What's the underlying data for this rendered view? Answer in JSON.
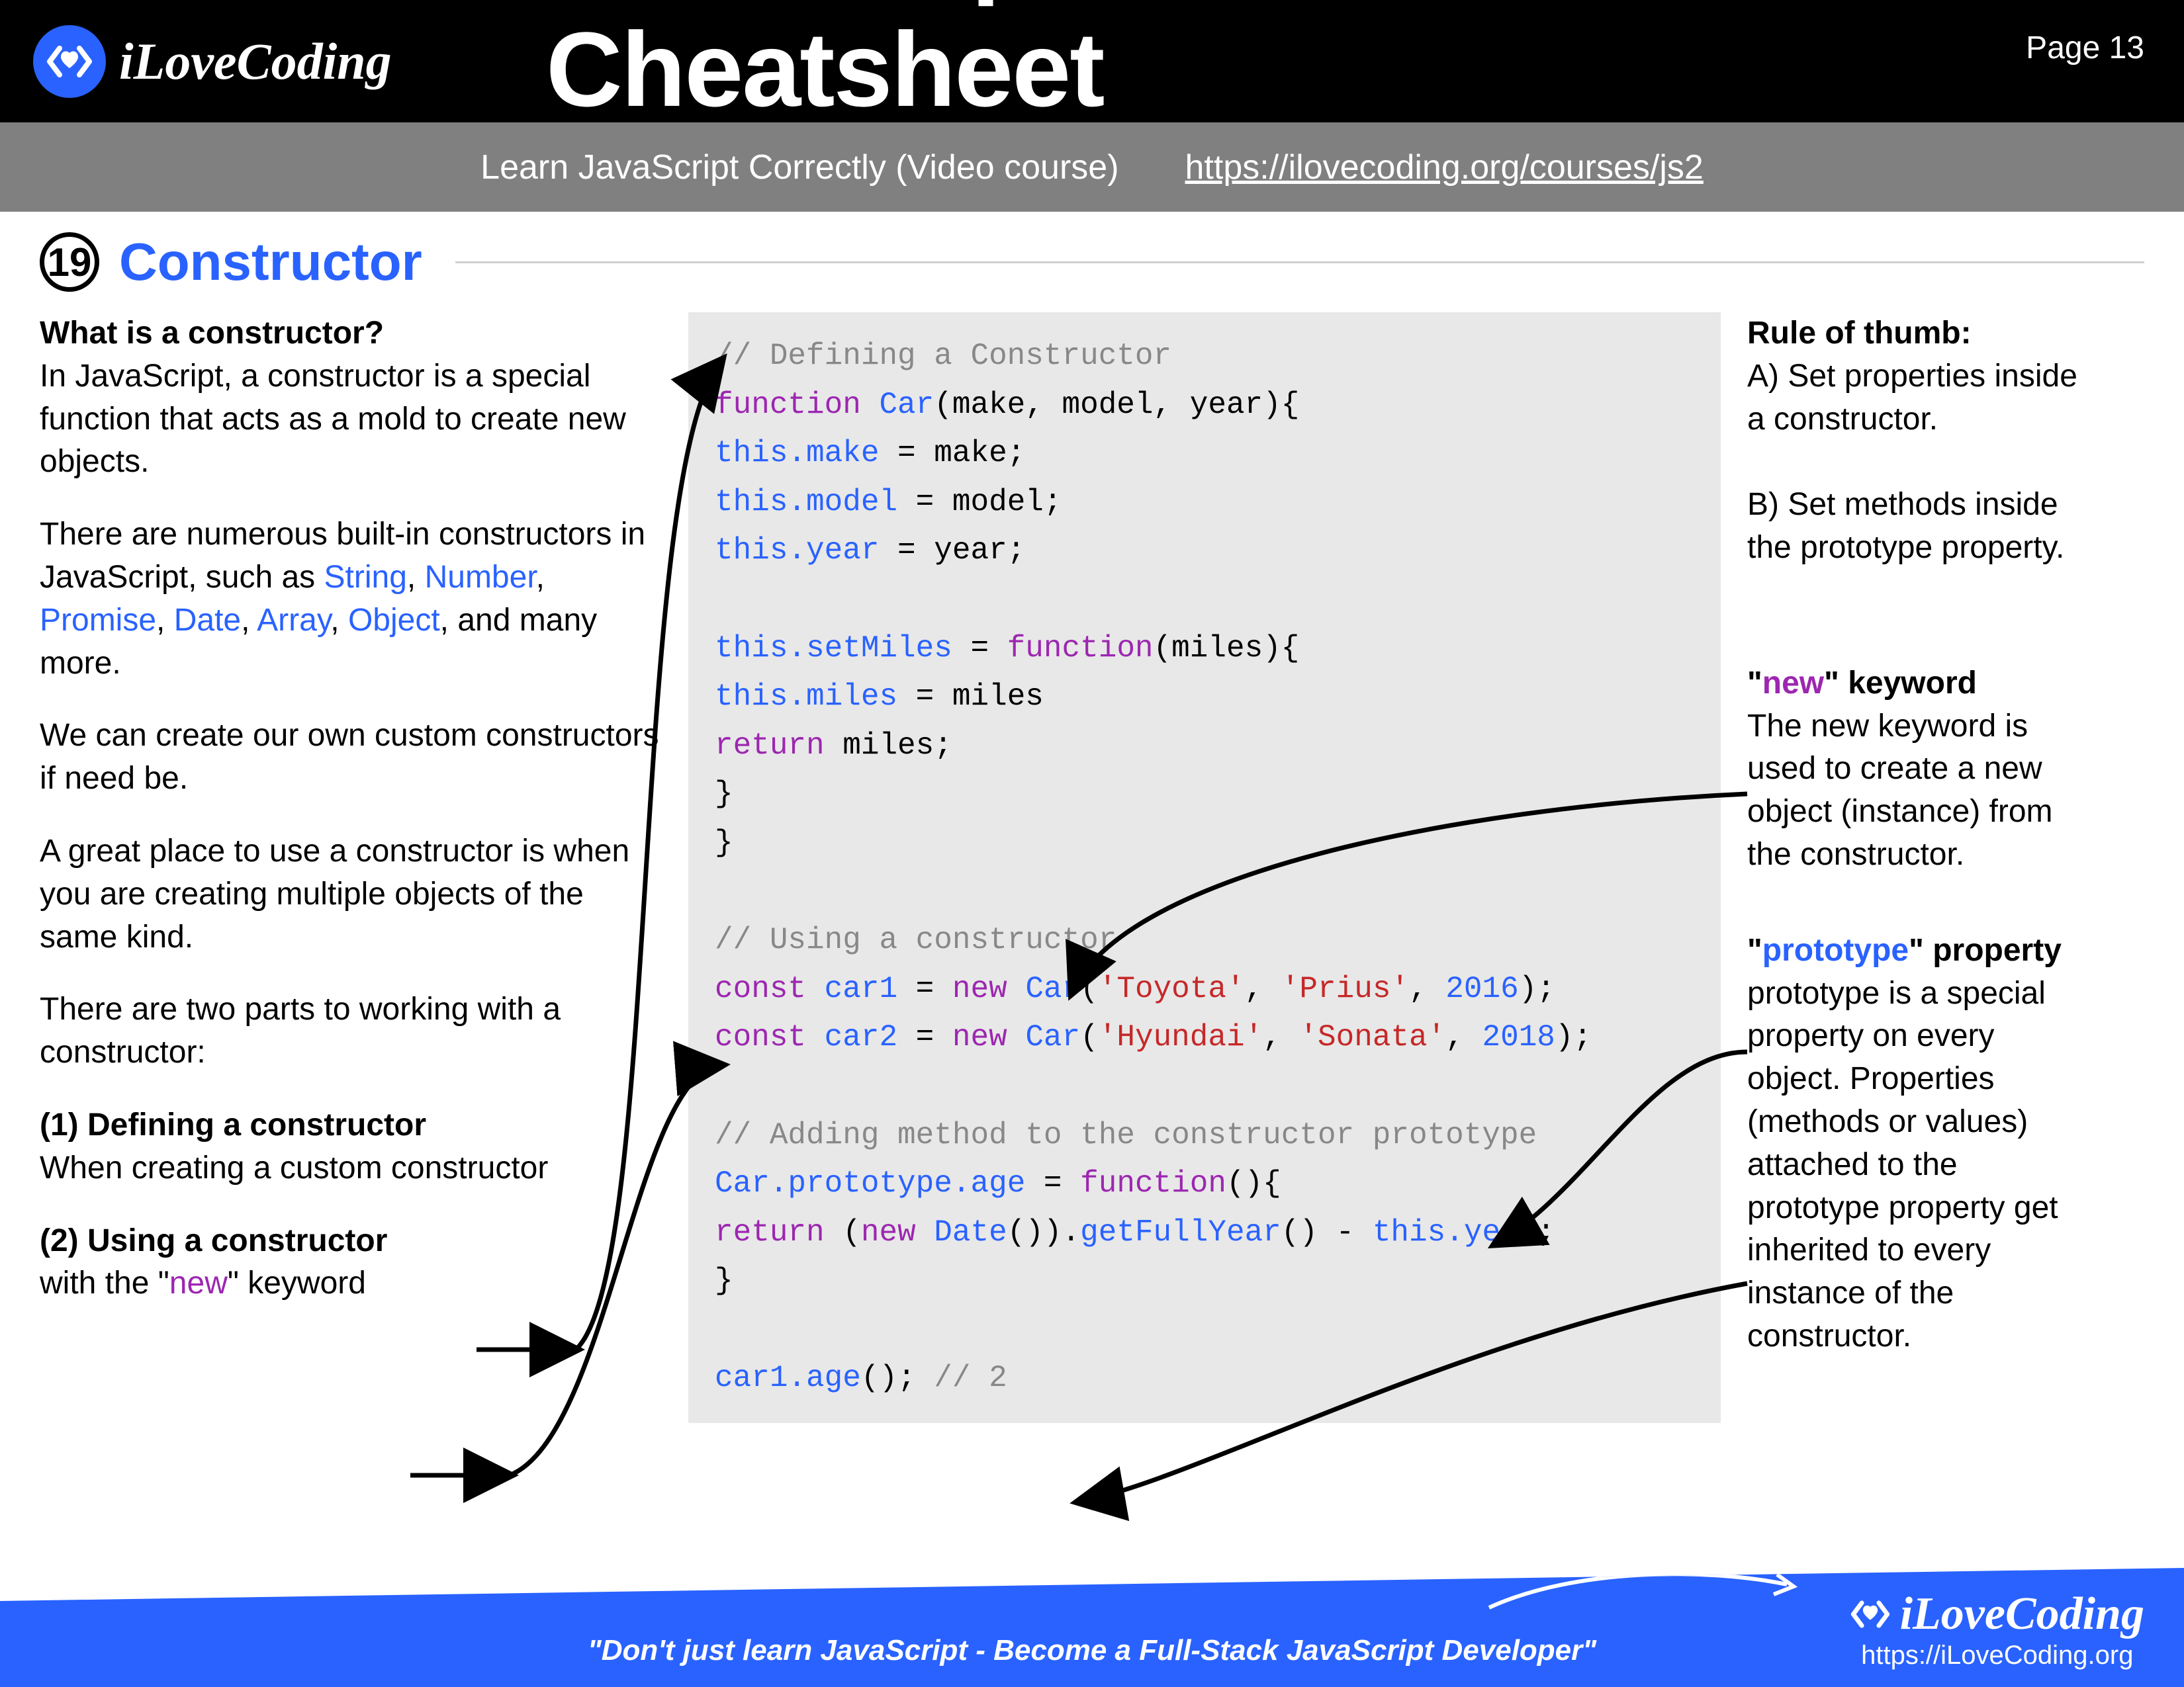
{
  "header": {
    "brand": "iLoveCoding",
    "title": "JavaScript Cheatsheet",
    "page_label": "Page 13",
    "subtitle": "Learn JavaScript Correctly (Video course)",
    "link": "https://ilovecoding.org/courses/js2"
  },
  "section": {
    "number": "19",
    "title": "Constructor"
  },
  "left": {
    "q_title": "What is a constructor?",
    "p1": "In JavaScript, a constructor is a special function that acts as a mold to create new objects.",
    "p2a": "There are numerous built-in constructors in JavaScript, such as ",
    "builtins": [
      "String",
      "Number",
      "Promise",
      "Date",
      "Array",
      "Object"
    ],
    "p2b": ", and many more.",
    "p3": "We can create our own custom constructors if need be.",
    "p4": "A great place to use a constructor is when you are creating multiple objects of the same kind.",
    "p5": "There are two parts to working with a constructor:",
    "part1_title": "(1) Defining a constructor",
    "part1_body": "When creating a custom constructor",
    "part2_title": "(2) Using a constructor",
    "part2_body_a": "with the \"",
    "part2_body_new": "new",
    "part2_body_b": "\" keyword"
  },
  "code": {
    "c1": "// Defining a Constructor",
    "l1a": "function",
    "l1b": " Car",
    "l1c": "(make, model, year){",
    "l2a": "  this",
    "l2b": ".make",
    "l2c": " = make;",
    "l3a": "  this",
    "l3b": ".model",
    "l3c": " = model;",
    "l4a": "  this",
    "l4b": ".year",
    "l4c": " = year;",
    "l5a": "  this",
    "l5b": ".setMiles",
    "l5c": " = ",
    "l5d": "function",
    "l5e": "(miles){",
    "l6a": "    this",
    "l6b": ".miles",
    "l6c": " = miles",
    "l7a": "    return",
    "l7b": " miles;",
    "l8": "  }",
    "l9": "}",
    "c2": "// Using a constructor",
    "l10a": "const",
    "l10b": " car1",
    "l10c": " = ",
    "l10d": "new",
    "l10e": " Car",
    "l10f": "(",
    "l10g": "'Toyota'",
    "l10h": ", ",
    "l10i": "'Prius'",
    "l10j": ", ",
    "l10k": "2016",
    "l10l": ");",
    "l11a": "const",
    "l11b": " car2",
    "l11c": " = ",
    "l11d": "new",
    "l11e": " Car",
    "l11f": "(",
    "l11g": "'Hyundai'",
    "l11h": ", ",
    "l11i": "'Sonata'",
    "l11j": ", ",
    "l11k": "2018",
    "l11l": ");",
    "c3": "// Adding method to the constructor prototype",
    "l12a": "Car",
    "l12b": ".prototype",
    "l12c": ".age",
    "l12d": " = ",
    "l12e": "function",
    "l12f": "(){",
    "l13a": "  return",
    "l13b": " (",
    "l13c": "new",
    "l13d": " Date",
    "l13e": "()).",
    "l13f": "getFullYear",
    "l13g": "() - ",
    "l13h": "this",
    "l13i": ".year",
    "l13j": ";",
    "l14": "}",
    "l15a": "car1",
    "l15b": ".age",
    "l15c": "(); ",
    "l15d": "// 2"
  },
  "right": {
    "rule_title": "Rule of thumb:",
    "rule_a": "A) Set properties inside a constructor.",
    "rule_b": "B) Set methods inside the prototype property.",
    "new_title_a": "\"",
    "new_title_b": "new",
    "new_title_c": "\" keyword",
    "new_body": "The new keyword is used to create a new object (instance) from the constructor.",
    "proto_title_a": "\"",
    "proto_title_b": "prototype",
    "proto_title_c": "\" property",
    "proto_body": "prototype is a special property on every object. Properties (methods or values) attached to the prototype property get inherited to every instance of the constructor."
  },
  "footer": {
    "quote": "\"Don't just learn JavaScript - Become a Full-Stack JavaScript Developer\"",
    "brand": "iLoveCoding",
    "url": "https://iLoveCoding.org"
  }
}
